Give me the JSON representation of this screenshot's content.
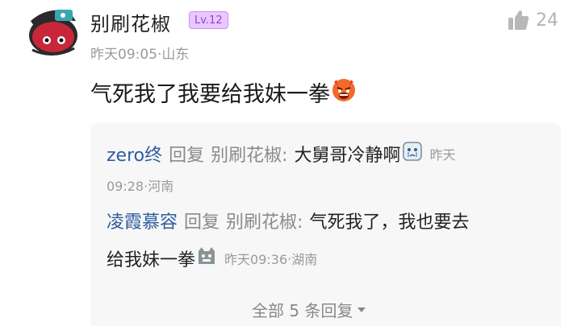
{
  "post": {
    "username": "别刷花椒",
    "level": "Lv.12",
    "time": "昨天09:05",
    "location": "山东",
    "likes": "24",
    "comment_text": "气死我了我要给我妹一拳",
    "comment_emoji": "angry-face-emoji"
  },
  "replies": [
    {
      "author": "zero终",
      "reply_word": "回复",
      "target": "别刷花椒:",
      "text": "大舅哥冷静啊",
      "emoji": "crying-face-emoji",
      "time_part1": "昨天",
      "time_part2": "09:28",
      "location": "河南"
    },
    {
      "author": "凌霞慕容",
      "reply_word": "回复",
      "target": "别刷花椒:",
      "text_line1": "气死我了，我也要去",
      "text_line2": "给我妹一拳",
      "emoji": "cat-face-emoji",
      "time": "昨天09:36",
      "location": "湖南"
    }
  ],
  "more": {
    "label": "全部 5 条回复"
  },
  "colors": {
    "author_blue": "#2e5c9e",
    "badge_purple": "#9a3fd8",
    "meta_gray": "#9a9a9a"
  }
}
